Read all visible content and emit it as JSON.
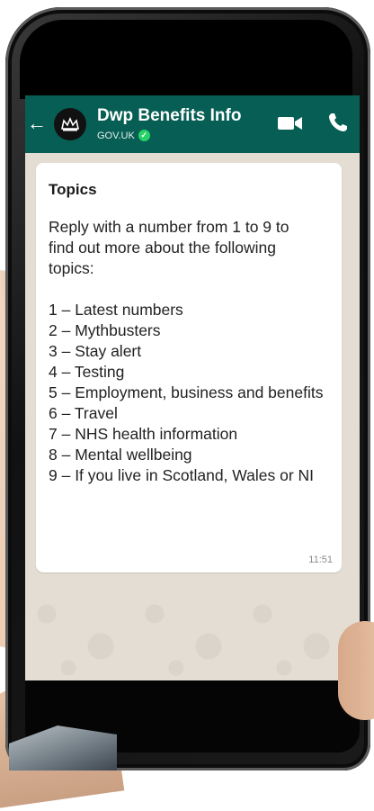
{
  "chat": {
    "contact_name": "Dwp Benefits Info",
    "contact_subtitle": "GOV.UK",
    "back_icon": "back-arrow-icon",
    "verified_icon": "verified-check-icon",
    "header_color": "#075e54"
  },
  "message": {
    "title": "Topics",
    "intro": "Reply with a number from 1 to 9 to find out more about the following topics:",
    "topics": [
      "1 – Latest numbers",
      "2 – Mythbusters",
      "3 – Stay alert",
      "4 – Testing",
      "5 – Employment, business and benefits",
      "6 – Travel",
      "7 – NHS health information",
      "8 – Mental wellbeing",
      "9 – If you live in Scotland, Wales or NI"
    ],
    "time": "11:51"
  }
}
